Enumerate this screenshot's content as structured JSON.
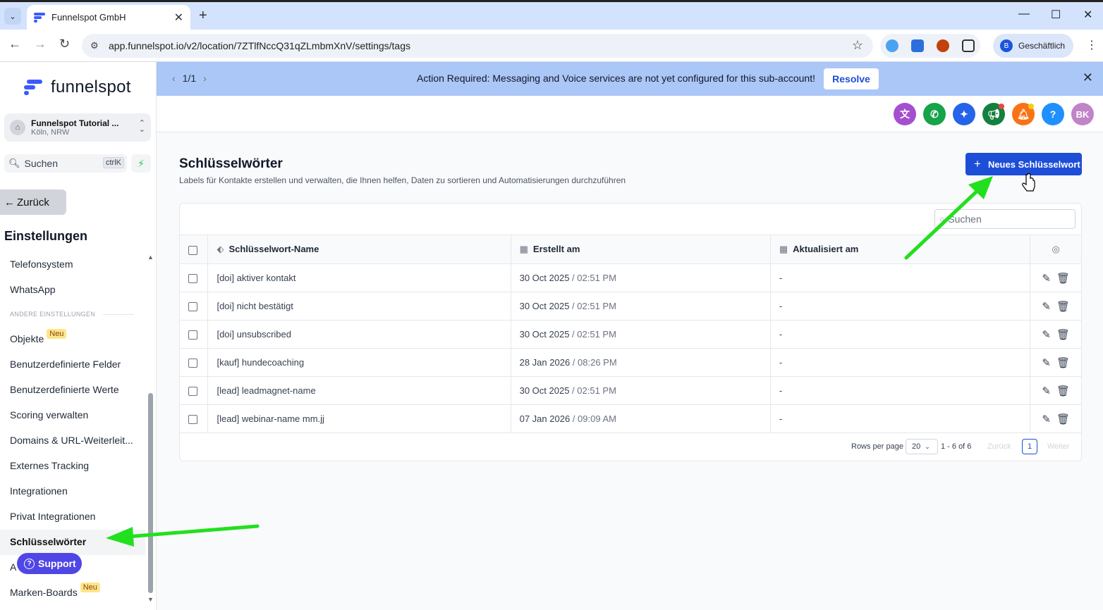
{
  "browser": {
    "tab_title": "Funnelspot GmbH",
    "url": "app.funnelspot.io/v2/location/7ZTlfNccQ31qZLmbmXnV/settings/tags",
    "profile_initial": "B",
    "profile_label": "Geschäftlich"
  },
  "sidebar": {
    "logo_text": "funnelspot",
    "account_name": "Funnelspot Tutorial ...",
    "account_location": "Köln, NRW",
    "search_label": "Suchen",
    "search_shortcut": "ctrlK",
    "back_label": "Zurück",
    "settings_title": "Einstellungen",
    "section_label": "ANDERE EINSTELLUNGEN",
    "new_badge": "Neu",
    "items": [
      {
        "label": "Telefonsystem"
      },
      {
        "label": "WhatsApp"
      },
      {
        "label": "Objekte"
      },
      {
        "label": "Benutzerdefinierte Felder"
      },
      {
        "label": "Benutzerdefinierte Werte"
      },
      {
        "label": "Scoring verwalten"
      },
      {
        "label": "Domains & URL-Weiterleit..."
      },
      {
        "label": "Externes Tracking"
      },
      {
        "label": "Integrationen"
      },
      {
        "label": "Privat Integrationen"
      },
      {
        "label": "Schlüsselwörter"
      },
      {
        "label": "A"
      },
      {
        "label": "Marken-Boards"
      }
    ],
    "support_label": "Support"
  },
  "banner": {
    "pager": "1/1",
    "message": "Action Required: Messaging and Voice services are not yet configured for this sub-account!",
    "resolve_label": "Resolve"
  },
  "header": {
    "avatar_initials": "BK",
    "help_glyph": "?",
    "colors": {
      "translate": "#a34fd0",
      "phone": "#16a34a",
      "ai": "#2563eb",
      "megaphone": "#15803d",
      "bell": "#f97316",
      "help": "#1e90ff",
      "avatar": "#c084c7"
    }
  },
  "page": {
    "title": "Schlüsselwörter",
    "subtitle": "Labels für Kontakte erstellen und verwalten, die Ihnen helfen, Daten zu sortieren und Automatisierungen durchzuführen",
    "new_button": "Neues Schlüsselwort",
    "search_placeholder": "Suchen"
  },
  "table": {
    "columns": [
      "Schlüsselwort-Name",
      "Erstellt am",
      "Aktualisiert am"
    ],
    "rows": [
      {
        "name": "[doi] aktiver kontakt",
        "date": "30 Oct 2025",
        "time": "02:51 PM",
        "updated": "-"
      },
      {
        "name": "[doi] nicht bestätigt",
        "date": "30 Oct 2025",
        "time": "02:51 PM",
        "updated": "-"
      },
      {
        "name": "[doi] unsubscribed",
        "date": "30 Oct 2025",
        "time": "02:51 PM",
        "updated": "-"
      },
      {
        "name": "[kauf] hundecoaching",
        "date": "28 Jan 2026",
        "time": "08:26 PM",
        "updated": "-"
      },
      {
        "name": "[lead] leadmagnet-name",
        "date": "30 Oct 2025",
        "time": "02:51 PM",
        "updated": "-"
      },
      {
        "name": "[lead] webinar-name mm.jj",
        "date": "07 Jan 2026",
        "time": "09:09 AM",
        "updated": "-"
      }
    ]
  },
  "pagination": {
    "rows_per_page_label": "Rows per page",
    "rows_per_page": "20",
    "range": "1 - 6 of 6",
    "prev": "Zurück",
    "page": "1",
    "next": "Weiter"
  }
}
